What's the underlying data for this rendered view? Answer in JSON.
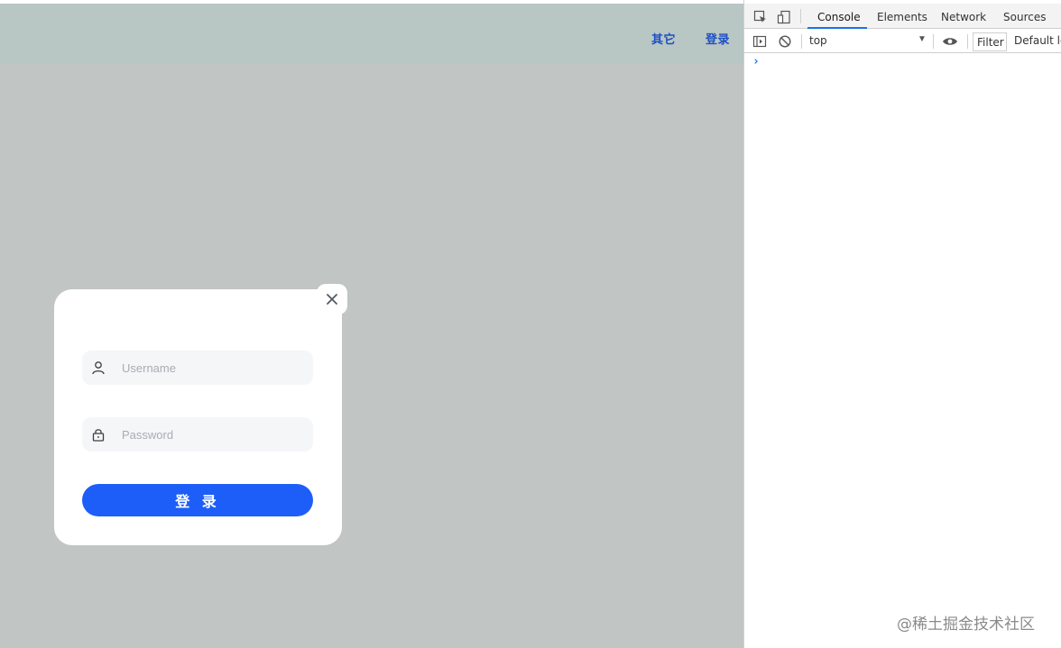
{
  "nav": {
    "other_label": "其它",
    "login_label": "登录"
  },
  "login_modal": {
    "username_placeholder": "Username",
    "password_placeholder": "Password",
    "submit_label": "登 录",
    "close_icon": "close-icon"
  },
  "devtools": {
    "tabs": [
      {
        "label": "Console",
        "active": true
      },
      {
        "label": "Elements",
        "active": false
      },
      {
        "label": "Network",
        "active": false
      },
      {
        "label": "Sources",
        "active": false
      }
    ],
    "context": "top",
    "filter_placeholder": "Filter",
    "levels_label": "Default levels",
    "prompt_symbol": "›"
  },
  "watermark": "@稀土掘金技术社区",
  "colors": {
    "primary_button": "#1e5ef8",
    "nav_link": "#1d4fc4",
    "devtools_accent": "#1a73e8"
  }
}
